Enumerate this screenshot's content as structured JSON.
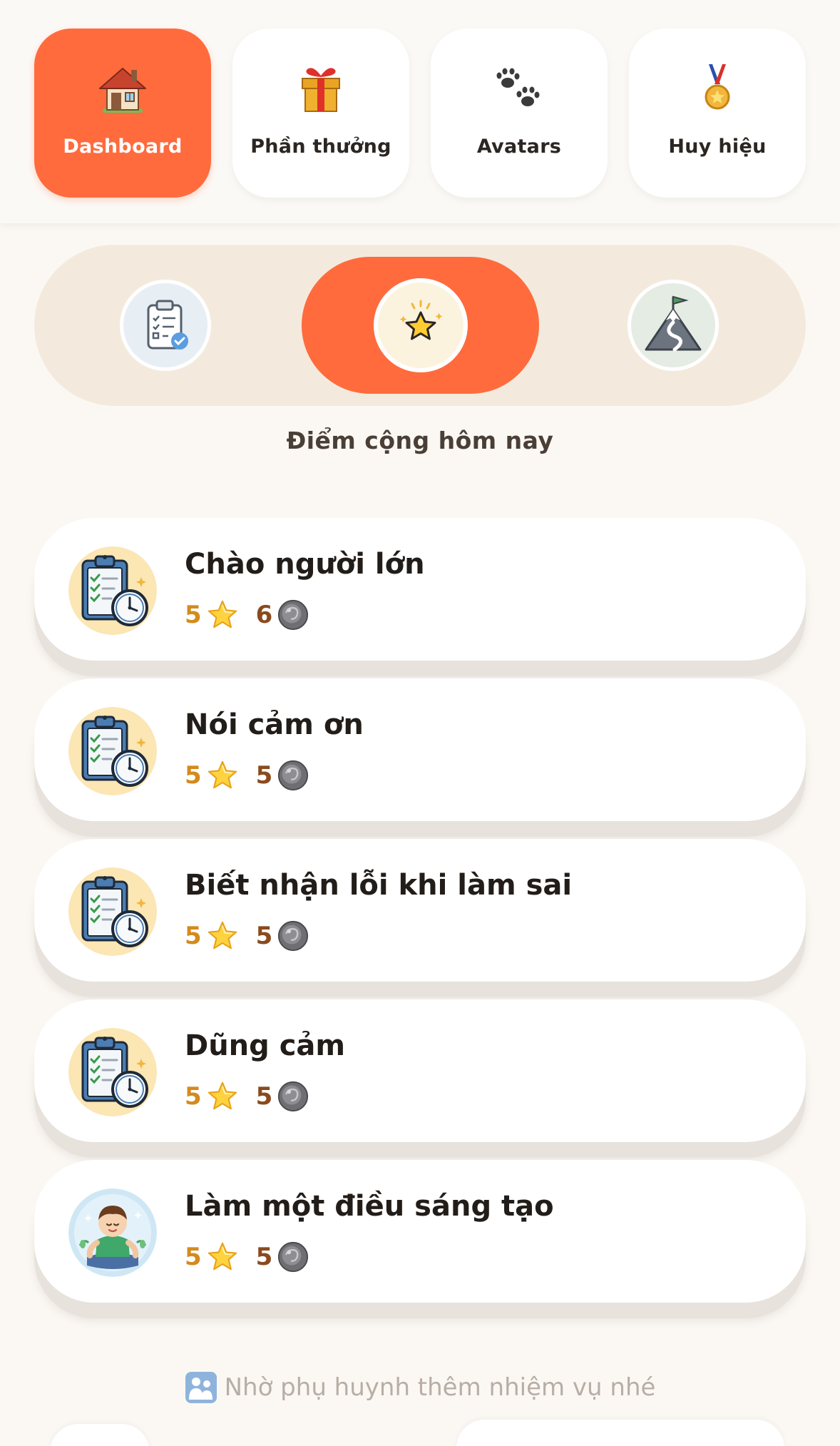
{
  "nav": {
    "tabs": [
      {
        "label": "Dashboard",
        "icon": "house-icon",
        "active": true
      },
      {
        "label": "Phần thưởng",
        "icon": "gift-icon",
        "active": false
      },
      {
        "label": "Avatars",
        "icon": "paw-icon",
        "active": false
      },
      {
        "label": "Huy hiệu",
        "icon": "medal-icon",
        "active": false
      }
    ]
  },
  "segment": {
    "options": [
      {
        "icon": "clipboard-check-icon",
        "active": false
      },
      {
        "icon": "star-icon",
        "active": true
      },
      {
        "icon": "mountain-flag-icon",
        "active": false
      }
    ]
  },
  "section_title": "Điểm cộng hôm nay",
  "tasks": [
    {
      "name": "Chào người lớn",
      "stars": "5",
      "coins": "6",
      "icon": "clipboard-clock-icon"
    },
    {
      "name": "Nói cảm ơn",
      "stars": "5",
      "coins": "5",
      "icon": "clipboard-clock-icon"
    },
    {
      "name": "Biết nhận lỗi khi làm sai",
      "stars": "5",
      "coins": "5",
      "icon": "clipboard-clock-icon"
    },
    {
      "name": "Dũng cảm",
      "stars": "5",
      "coins": "5",
      "icon": "clipboard-clock-icon"
    },
    {
      "name": "Làm một điều sáng tạo",
      "stars": "5",
      "coins": "5",
      "icon": "meditating-kid-icon"
    }
  ],
  "footer_hint": "Nhờ phụ huynh thêm nhiệm vụ nhé",
  "colors": {
    "accent": "#ff6b3d",
    "background": "#fbf8f4",
    "star_count": "#d48a1c",
    "coin_count": "#8a4a1e",
    "hint_text": "#b8aea5"
  }
}
